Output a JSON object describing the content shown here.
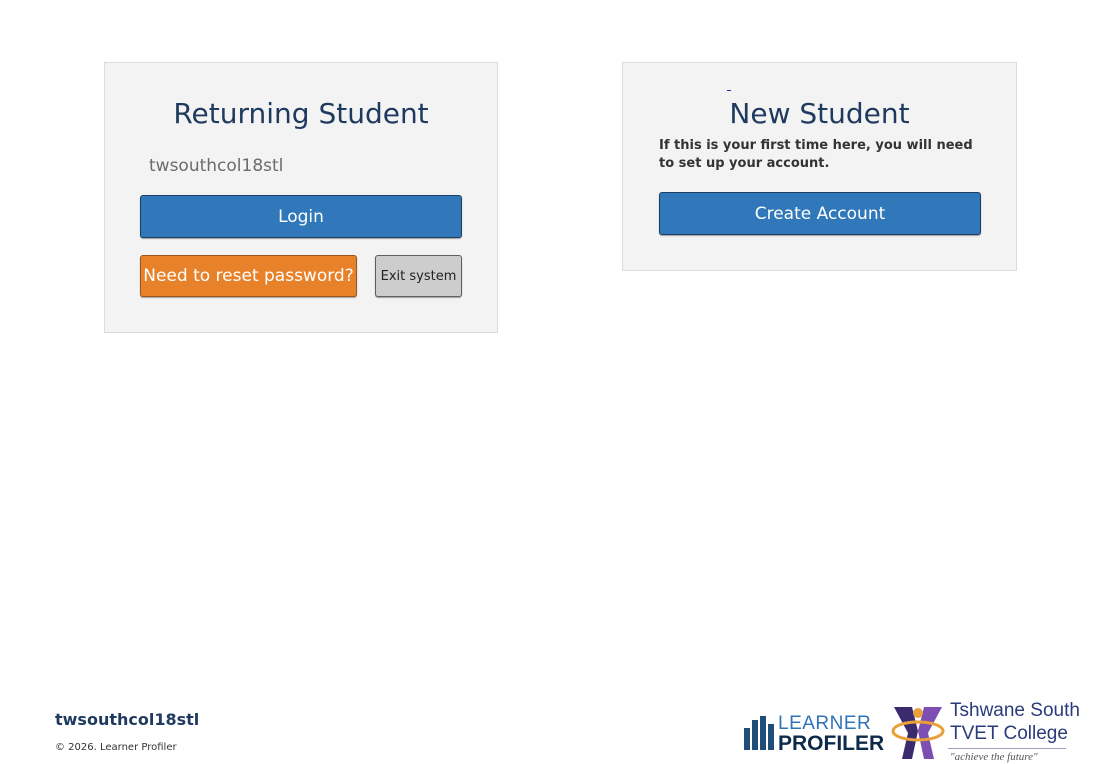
{
  "returning": {
    "title": "Returning Student",
    "username": "twsouthcol18stl",
    "login_label": "Login",
    "reset_label": "Need to reset password?",
    "exit_label": "Exit system"
  },
  "new_student": {
    "title": "New Student",
    "description": "If this is your first time here, you will need to set up your account.",
    "create_label": "Create Account"
  },
  "footer": {
    "username": "twsouthcol18stl",
    "copyright": "© 2026. Learner Profiler"
  },
  "logos": {
    "learner_profiler": {
      "line1": "LEARNER",
      "line2": "PROFILER"
    },
    "college": {
      "line1": "Tshwane South",
      "line2": "TVET College",
      "tagline": "\"achieve the future\""
    }
  },
  "colors": {
    "primary_button": "#3178ba",
    "warning_button": "#e8822a",
    "neutral_button": "#cdcdcd",
    "heading": "#1f3a5f",
    "panel_bg": "#f3f3f3"
  }
}
